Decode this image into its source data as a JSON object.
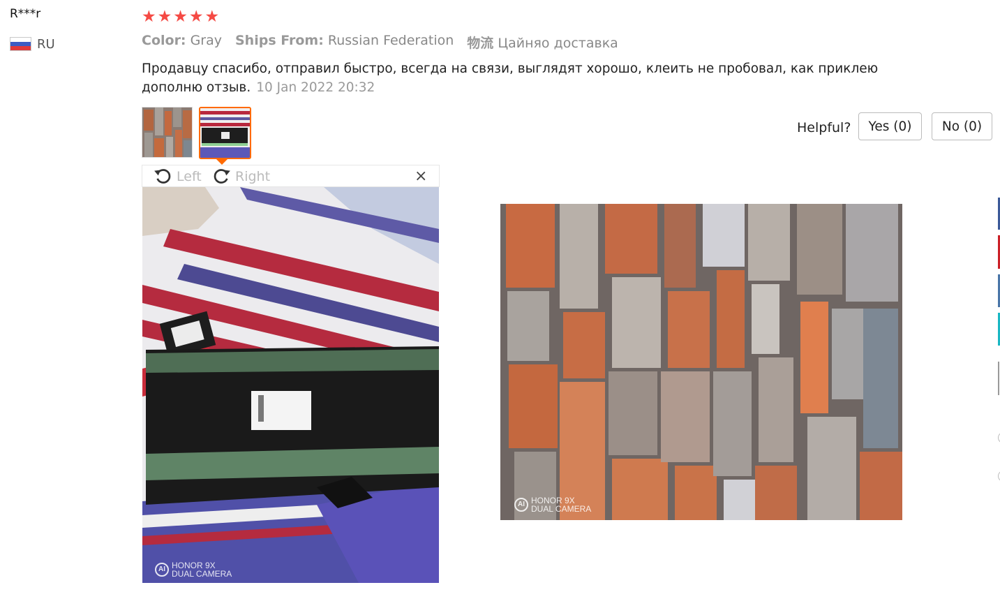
{
  "reviewer": {
    "name": "R***r",
    "country_code": "RU"
  },
  "rating": {
    "stars": 5,
    "max": 5
  },
  "attributes": [
    {
      "key": "Color:",
      "value": "Gray"
    },
    {
      "key": "Ships From:",
      "value": "Russian Federation"
    },
    {
      "key": "物流",
      "value": "Цайняо доставка"
    }
  ],
  "review": {
    "text": "Продавцу спасибо, отправил быстро, всегда на связи, выглядят хорошо, клеить не пробовал, как приклею дополню отзыв.",
    "date": "10 Jan 2022 20:32"
  },
  "helpful": {
    "label": "Helpful?",
    "yes": "Yes (0)",
    "no": "No (0)"
  },
  "viewer": {
    "rotate_left": "Left",
    "rotate_right": "Right",
    "close": "×"
  },
  "photos": {
    "watermark_line1": "HONOR 9X",
    "watermark_line2": "DUAL CAMERA"
  },
  "colors": {
    "star": "#f54a44",
    "selected_thumb_border": "#ff6a00"
  }
}
